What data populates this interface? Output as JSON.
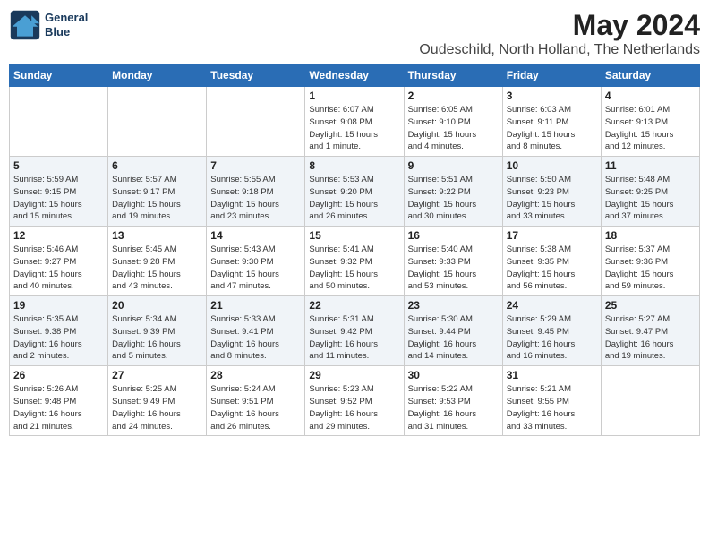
{
  "logo": {
    "line1": "General",
    "line2": "Blue"
  },
  "title": "May 2024",
  "location": "Oudeschild, North Holland, The Netherlands",
  "days_of_week": [
    "Sunday",
    "Monday",
    "Tuesday",
    "Wednesday",
    "Thursday",
    "Friday",
    "Saturday"
  ],
  "weeks": [
    [
      {
        "day": "",
        "info": ""
      },
      {
        "day": "",
        "info": ""
      },
      {
        "day": "",
        "info": ""
      },
      {
        "day": "1",
        "info": "Sunrise: 6:07 AM\nSunset: 9:08 PM\nDaylight: 15 hours\nand 1 minute."
      },
      {
        "day": "2",
        "info": "Sunrise: 6:05 AM\nSunset: 9:10 PM\nDaylight: 15 hours\nand 4 minutes."
      },
      {
        "day": "3",
        "info": "Sunrise: 6:03 AM\nSunset: 9:11 PM\nDaylight: 15 hours\nand 8 minutes."
      },
      {
        "day": "4",
        "info": "Sunrise: 6:01 AM\nSunset: 9:13 PM\nDaylight: 15 hours\nand 12 minutes."
      }
    ],
    [
      {
        "day": "5",
        "info": "Sunrise: 5:59 AM\nSunset: 9:15 PM\nDaylight: 15 hours\nand 15 minutes."
      },
      {
        "day": "6",
        "info": "Sunrise: 5:57 AM\nSunset: 9:17 PM\nDaylight: 15 hours\nand 19 minutes."
      },
      {
        "day": "7",
        "info": "Sunrise: 5:55 AM\nSunset: 9:18 PM\nDaylight: 15 hours\nand 23 minutes."
      },
      {
        "day": "8",
        "info": "Sunrise: 5:53 AM\nSunset: 9:20 PM\nDaylight: 15 hours\nand 26 minutes."
      },
      {
        "day": "9",
        "info": "Sunrise: 5:51 AM\nSunset: 9:22 PM\nDaylight: 15 hours\nand 30 minutes."
      },
      {
        "day": "10",
        "info": "Sunrise: 5:50 AM\nSunset: 9:23 PM\nDaylight: 15 hours\nand 33 minutes."
      },
      {
        "day": "11",
        "info": "Sunrise: 5:48 AM\nSunset: 9:25 PM\nDaylight: 15 hours\nand 37 minutes."
      }
    ],
    [
      {
        "day": "12",
        "info": "Sunrise: 5:46 AM\nSunset: 9:27 PM\nDaylight: 15 hours\nand 40 minutes."
      },
      {
        "day": "13",
        "info": "Sunrise: 5:45 AM\nSunset: 9:28 PM\nDaylight: 15 hours\nand 43 minutes."
      },
      {
        "day": "14",
        "info": "Sunrise: 5:43 AM\nSunset: 9:30 PM\nDaylight: 15 hours\nand 47 minutes."
      },
      {
        "day": "15",
        "info": "Sunrise: 5:41 AM\nSunset: 9:32 PM\nDaylight: 15 hours\nand 50 minutes."
      },
      {
        "day": "16",
        "info": "Sunrise: 5:40 AM\nSunset: 9:33 PM\nDaylight: 15 hours\nand 53 minutes."
      },
      {
        "day": "17",
        "info": "Sunrise: 5:38 AM\nSunset: 9:35 PM\nDaylight: 15 hours\nand 56 minutes."
      },
      {
        "day": "18",
        "info": "Sunrise: 5:37 AM\nSunset: 9:36 PM\nDaylight: 15 hours\nand 59 minutes."
      }
    ],
    [
      {
        "day": "19",
        "info": "Sunrise: 5:35 AM\nSunset: 9:38 PM\nDaylight: 16 hours\nand 2 minutes."
      },
      {
        "day": "20",
        "info": "Sunrise: 5:34 AM\nSunset: 9:39 PM\nDaylight: 16 hours\nand 5 minutes."
      },
      {
        "day": "21",
        "info": "Sunrise: 5:33 AM\nSunset: 9:41 PM\nDaylight: 16 hours\nand 8 minutes."
      },
      {
        "day": "22",
        "info": "Sunrise: 5:31 AM\nSunset: 9:42 PM\nDaylight: 16 hours\nand 11 minutes."
      },
      {
        "day": "23",
        "info": "Sunrise: 5:30 AM\nSunset: 9:44 PM\nDaylight: 16 hours\nand 14 minutes."
      },
      {
        "day": "24",
        "info": "Sunrise: 5:29 AM\nSunset: 9:45 PM\nDaylight: 16 hours\nand 16 minutes."
      },
      {
        "day": "25",
        "info": "Sunrise: 5:27 AM\nSunset: 9:47 PM\nDaylight: 16 hours\nand 19 minutes."
      }
    ],
    [
      {
        "day": "26",
        "info": "Sunrise: 5:26 AM\nSunset: 9:48 PM\nDaylight: 16 hours\nand 21 minutes."
      },
      {
        "day": "27",
        "info": "Sunrise: 5:25 AM\nSunset: 9:49 PM\nDaylight: 16 hours\nand 24 minutes."
      },
      {
        "day": "28",
        "info": "Sunrise: 5:24 AM\nSunset: 9:51 PM\nDaylight: 16 hours\nand 26 minutes."
      },
      {
        "day": "29",
        "info": "Sunrise: 5:23 AM\nSunset: 9:52 PM\nDaylight: 16 hours\nand 29 minutes."
      },
      {
        "day": "30",
        "info": "Sunrise: 5:22 AM\nSunset: 9:53 PM\nDaylight: 16 hours\nand 31 minutes."
      },
      {
        "day": "31",
        "info": "Sunrise: 5:21 AM\nSunset: 9:55 PM\nDaylight: 16 hours\nand 33 minutes."
      },
      {
        "day": "",
        "info": ""
      }
    ]
  ]
}
